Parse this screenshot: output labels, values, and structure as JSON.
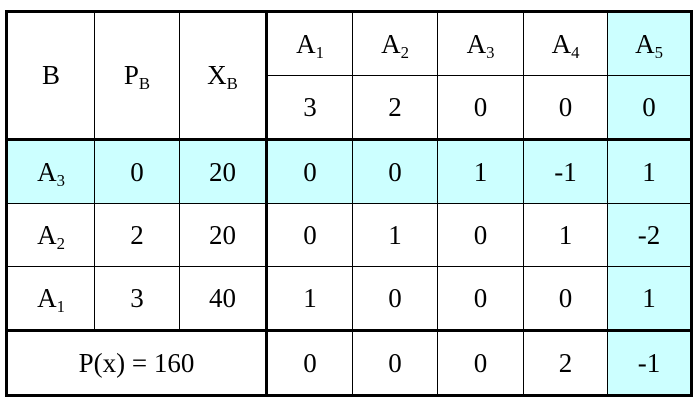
{
  "header": {
    "basis_label": {
      "main": "B",
      "sub": ""
    },
    "pb_label": {
      "main": "P",
      "sub": "B"
    },
    "xb_label": {
      "main": "X",
      "sub": "B"
    },
    "columns": [
      {
        "main": "A",
        "sub": "1",
        "cost": "3"
      },
      {
        "main": "A",
        "sub": "2",
        "cost": "2"
      },
      {
        "main": "A",
        "sub": "3",
        "cost": "0"
      },
      {
        "main": "A",
        "sub": "4",
        "cost": "0"
      },
      {
        "main": "A",
        "sub": "5",
        "cost": "0"
      }
    ]
  },
  "rows": [
    {
      "basis": {
        "main": "A",
        "sub": "3"
      },
      "pb": "0",
      "xb": "20",
      "values": [
        "0",
        "0",
        "1",
        "-1",
        "1"
      ]
    },
    {
      "basis": {
        "main": "A",
        "sub": "2"
      },
      "pb": "2",
      "xb": "20",
      "values": [
        "0",
        "1",
        "0",
        "1",
        "-2"
      ]
    },
    {
      "basis": {
        "main": "A",
        "sub": "1"
      },
      "pb": "3",
      "xb": "40",
      "values": [
        "1",
        "0",
        "0",
        "0",
        "1"
      ]
    }
  ],
  "total": {
    "label": "P(x) = 160",
    "values": [
      "0",
      "0",
      "0",
      "2",
      "-1"
    ]
  },
  "highlight": {
    "color": "#ccffff",
    "pivot_row_index": 0,
    "pivot_column_index": 4
  }
}
